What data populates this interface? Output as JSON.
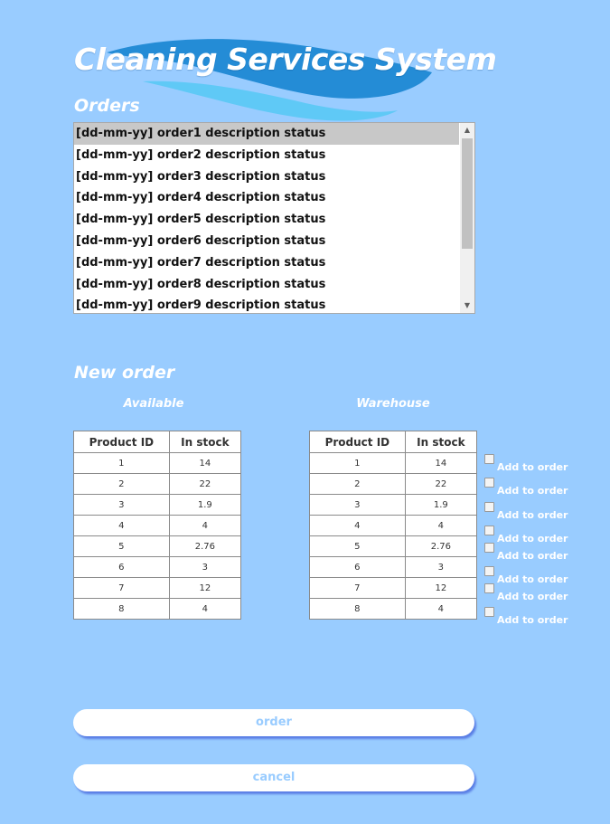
{
  "header": {
    "title": "Cleaning Services System"
  },
  "orders": {
    "heading": "Orders",
    "items": [
      "[dd-mm-yy] order1  description status",
      "[dd-mm-yy] order2 description status",
      "[dd-mm-yy] order3 description status",
      "[dd-mm-yy] order4 description status",
      "[dd-mm-yy] order5 description status",
      "[dd-mm-yy] order6 description status",
      "[dd-mm-yy] order7 description status",
      "[dd-mm-yy] order8 description status",
      "[dd-mm-yy] order9 description status"
    ],
    "selected_index": 0
  },
  "new_order": {
    "heading": "New order",
    "available": {
      "heading": "Available",
      "columns": [
        "Product ID",
        "In stock"
      ],
      "rows": [
        [
          "1",
          "14"
        ],
        [
          "2",
          "22"
        ],
        [
          "3",
          "1.9"
        ],
        [
          "4",
          "4"
        ],
        [
          "5",
          "2.76"
        ],
        [
          "6",
          "3"
        ],
        [
          "7",
          "12"
        ],
        [
          "8",
          "4"
        ]
      ]
    },
    "warehouse": {
      "heading": "Warehouse",
      "columns": [
        "Product ID",
        "In stock"
      ],
      "rows": [
        [
          "1",
          "14"
        ],
        [
          "2",
          "22"
        ],
        [
          "3",
          "1.9"
        ],
        [
          "4",
          "4"
        ],
        [
          "5",
          "2.76"
        ],
        [
          "6",
          "3"
        ],
        [
          "7",
          "12"
        ],
        [
          "8",
          "4"
        ]
      ]
    },
    "add_to_order_label": "Add to order",
    "add_to_order_count": 8
  },
  "buttons": {
    "order": "order",
    "cancel": "cancel"
  },
  "colors": {
    "background": "#99ccff",
    "title_text": "#ffffff",
    "button_text": "#99ccff",
    "wave_dark": "#1e88d4",
    "wave_light": "#5cc8f5"
  }
}
